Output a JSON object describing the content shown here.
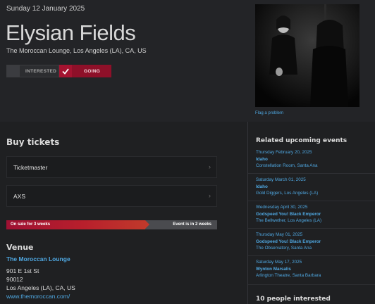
{
  "event": {
    "date": "Sunday 12 January 2025",
    "title": "Elysian Fields",
    "venue_line": "The Moroccan Lounge, Los Angeles (LA), CA, US"
  },
  "attendance": {
    "interested_label": "INTERESTED",
    "going_label": "GOING",
    "selected": "going",
    "going_color": "#8e1029"
  },
  "photo": {
    "flag_label": "Flag a problem"
  },
  "buy_tickets": {
    "heading": "Buy tickets",
    "providers": [
      {
        "label": "Ticketmaster"
      },
      {
        "label": "AXS"
      }
    ],
    "sale_status": {
      "left_label": "On sale for 3 weeks",
      "right_label": "Event is in 2 weeks"
    }
  },
  "venue": {
    "heading": "Venue",
    "name": "The Moroccan Lounge",
    "address_line1": "901 E 1st St",
    "address_line2": "90012",
    "address_line3": "Los Angeles (LA), CA, US",
    "website": "www.themoroccan.com/"
  },
  "related": {
    "heading": "Related upcoming events",
    "events": [
      {
        "date": "Thursday February 20, 2025",
        "artist": "Idaho",
        "place": "Constellation Room, Santa Ana"
      },
      {
        "date": "Saturday March 01, 2025",
        "artist": "Idaho",
        "place": "Gold Diggers, Los Angeles (LA)"
      },
      {
        "date": "Wednesday April 30, 2025",
        "artist": "Godspeed You! Black Emperor",
        "place": "The Bellwether, Los Angeles (LA)"
      },
      {
        "date": "Thursday May 01, 2025",
        "artist": "Godspeed You! Black Emperor",
        "place": "The Observatory, Santa Ana"
      },
      {
        "date": "Saturday May 17, 2025",
        "artist": "Wynton Marsalis",
        "place": "Arlington Theatre, Santa Barbara"
      }
    ]
  },
  "interested": {
    "heading": "10 people interested"
  },
  "colors": {
    "link": "#4fa8e2",
    "accent": "#8e1029",
    "background": "#1f2022"
  }
}
